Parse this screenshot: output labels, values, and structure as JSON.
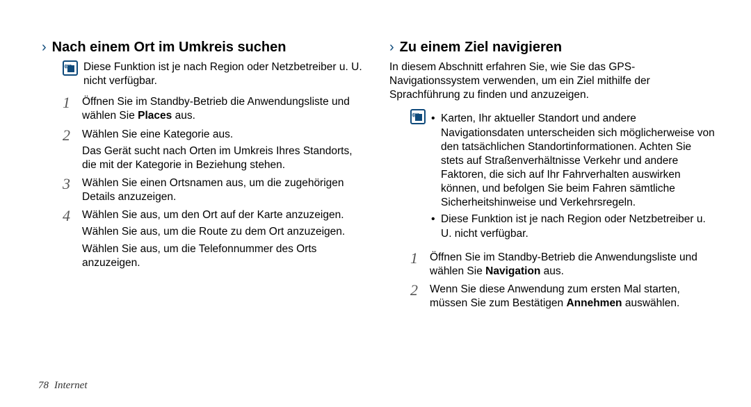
{
  "left": {
    "heading": "Nach einem Ort im Umkreis suchen",
    "note": "Diese Funktion ist je nach Region oder Netzbetreiber u. U. nicht verfügbar.",
    "steps": {
      "s1_a": "Öffnen Sie im Standby-Betrieb die Anwendungsliste und wählen Sie ",
      "s1_b": "Places",
      "s1_c": " aus.",
      "s2": "Wählen Sie eine Kategorie aus.",
      "s2_sub": "Das Gerät sucht nach Orten im Umkreis Ihres Standorts, die mit der Kategorie in Beziehung stehen.",
      "s3": "Wählen Sie einen Ortsnamen aus, um die zugehörigen Details anzuzeigen.",
      "s4_a": "Wählen Sie        aus, um den Ort auf der Karte anzuzeigen.",
      "s4_b": "Wählen Sie        aus, um die Route zu dem Ort anzuzeigen.",
      "s4_c": "Wählen Sie        aus, um die Telefonnummer des Orts anzuzeigen."
    }
  },
  "right": {
    "heading": "Zu einem Ziel navigieren",
    "intro": "In diesem Abschnitt erfahren Sie, wie Sie das GPS-Navigationssystem verwenden, um ein Ziel mithilfe der Sprachführung zu finden und anzuzeigen.",
    "note_bullets": {
      "b1": "Karten, Ihr aktueller Standort und andere Navigationsdaten unterscheiden sich möglicherweise von den tatsächlichen Standortinformationen. Achten Sie stets auf Straßenverhältnisse Verkehr und andere Faktoren, die sich auf Ihr Fahrverhalten auswirken können, und befolgen Sie beim Fahren sämtliche Sicherheitshinweise und Verkehrsregeln.",
      "b2": "Diese Funktion ist je nach Region oder Netzbetreiber u. U. nicht verfügbar."
    },
    "steps": {
      "s1_a": "Öffnen Sie im Standby-Betrieb die Anwendungsliste und wählen Sie ",
      "s1_b": "Navigation",
      "s1_c": " aus.",
      "s2_a": "Wenn Sie diese Anwendung zum ersten Mal starten, müssen Sie zum Bestätigen ",
      "s2_b": "Annehmen",
      "s2_c": " auswählen."
    }
  },
  "footer": {
    "page": "78",
    "section": "Internet"
  }
}
